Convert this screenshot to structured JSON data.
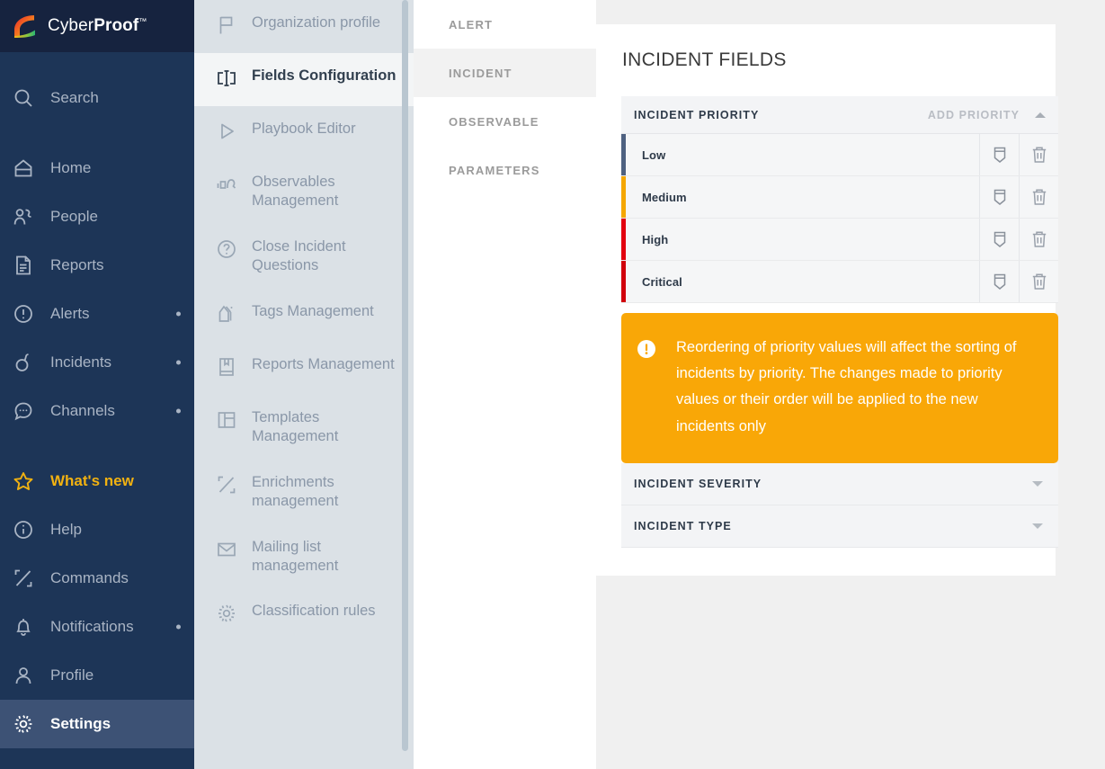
{
  "brand": {
    "name_light": "Cyber",
    "name_bold": "Proof",
    "trademark": "™"
  },
  "sidebar": {
    "items": [
      {
        "label": "Search",
        "icon": "search-icon",
        "dot": false,
        "state": "normal"
      },
      {
        "label": "Home",
        "icon": "home-icon",
        "dot": false,
        "state": "normal"
      },
      {
        "label": "People",
        "icon": "people-icon",
        "dot": false,
        "state": "normal"
      },
      {
        "label": "Reports",
        "icon": "document-icon",
        "dot": false,
        "state": "normal"
      },
      {
        "label": "Alerts",
        "icon": "alert-circle-icon",
        "dot": true,
        "state": "normal"
      },
      {
        "label": "Incidents",
        "icon": "bomb-icon",
        "dot": true,
        "state": "normal"
      },
      {
        "label": "Channels",
        "icon": "chat-icon",
        "dot": true,
        "state": "normal"
      },
      {
        "label": "What's new",
        "icon": "star-icon",
        "dot": false,
        "state": "highlight"
      },
      {
        "label": "Help",
        "icon": "info-circle-icon",
        "dot": false,
        "state": "normal"
      },
      {
        "label": "Commands",
        "icon": "commands-icon",
        "dot": false,
        "state": "normal"
      },
      {
        "label": "Notifications",
        "icon": "bell-icon",
        "dot": true,
        "state": "normal"
      },
      {
        "label": "Profile",
        "icon": "user-icon",
        "dot": false,
        "state": "normal"
      },
      {
        "label": "Settings",
        "icon": "gear-icon",
        "dot": false,
        "state": "active"
      }
    ]
  },
  "submenu": {
    "items": [
      {
        "label": "Organization profile",
        "icon": "flag-icon",
        "active": false
      },
      {
        "label": "Fields Configuration",
        "icon": "fields-icon",
        "active": true
      },
      {
        "label": "Playbook Editor",
        "icon": "play-icon",
        "active": false
      },
      {
        "label": "Observables Management",
        "icon": "observable-icon",
        "active": false
      },
      {
        "label": "Close Incident Questions",
        "icon": "question-icon",
        "active": false
      },
      {
        "label": "Tags Management",
        "icon": "tag-icon",
        "active": false
      },
      {
        "label": "Reports Management",
        "icon": "book-icon",
        "active": false
      },
      {
        "label": "Templates Management",
        "icon": "template-icon",
        "active": false
      },
      {
        "label": "Enrichments management",
        "icon": "enrichment-icon",
        "active": false
      },
      {
        "label": "Mailing list management",
        "icon": "mail-icon",
        "active": false
      },
      {
        "label": "Classification rules",
        "icon": "gear-small-icon",
        "active": false
      }
    ]
  },
  "tabs": [
    {
      "label": "ALERT",
      "active": false
    },
    {
      "label": "INCIDENT",
      "active": true
    },
    {
      "label": "OBSERVABLE",
      "active": false
    },
    {
      "label": "PARAMETERS",
      "active": false
    }
  ],
  "main": {
    "page_title": "INCIDENT FIELDS",
    "priority_panel": {
      "title": "INCIDENT PRIORITY",
      "action_label": "ADD PRIORITY",
      "collapse_icon": "caret-up-icon",
      "rows": [
        {
          "label": "Low",
          "color": "#4e6180",
          "severity_icon": "shield-icon",
          "delete_icon": "trash-icon"
        },
        {
          "label": "Medium",
          "color": "#f5a700",
          "severity_icon": "shield-icon",
          "delete_icon": "trash-icon"
        },
        {
          "label": "High",
          "color": "#e2000f",
          "severity_icon": "shield-icon",
          "delete_icon": "trash-icon"
        },
        {
          "label": "Critical",
          "color": "#d1000c",
          "severity_icon": "shield-icon",
          "delete_icon": "trash-icon"
        }
      ]
    },
    "alert_banner": {
      "icon": "exclamation-icon",
      "color": "#f9a707",
      "text": "Reordering of priority values will affect the sorting of incidents by priority. The changes made to priority values or their order will be applied to the new incidents only"
    },
    "collapsed_panels": [
      {
        "title": "INCIDENT SEVERITY",
        "expand_icon": "caret-down-icon"
      },
      {
        "title": "INCIDENT TYPE",
        "expand_icon": "caret-down-icon"
      }
    ]
  },
  "colors": {
    "sidebar_bg": "#1d3557",
    "sidebar_brand_bg": "#16233f",
    "sidebar_active": "#3d5275",
    "submenu_bg": "#dbe1e6",
    "accent_yellow": "#f2b211",
    "warning_orange": "#f9a707",
    "page_bg": "#f0f0f0"
  }
}
